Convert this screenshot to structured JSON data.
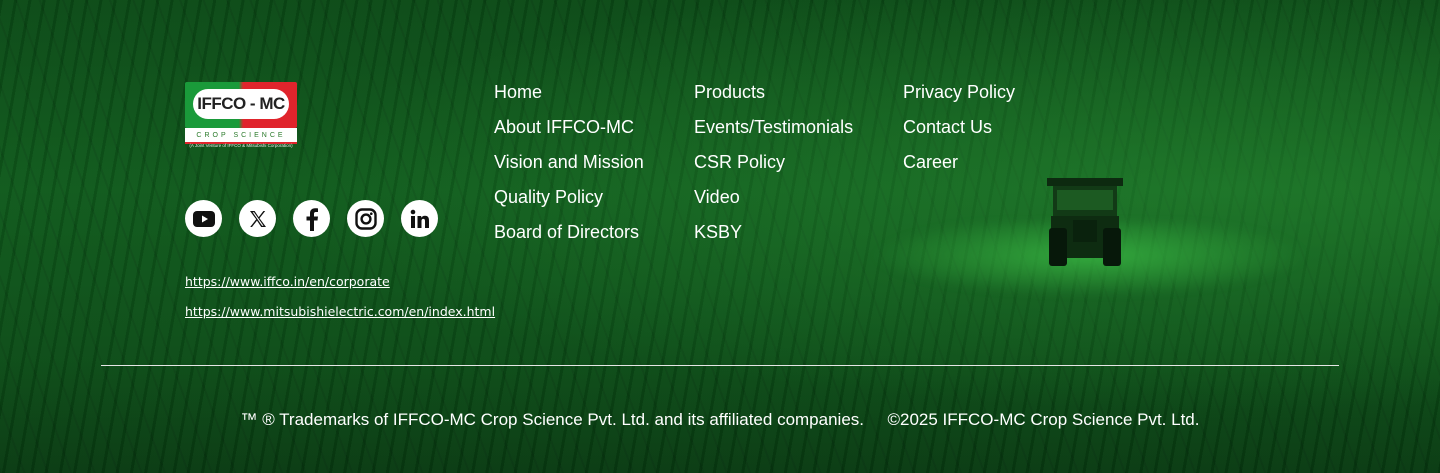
{
  "logo": {
    "name": "IFFCO - MC",
    "subtitle": "CROP SCIENCE",
    "joint_venture": "(A Joint Venture of IFFCO & Mitsubishi Corporation)"
  },
  "social": [
    {
      "name": "youtube",
      "icon": "youtube-icon"
    },
    {
      "name": "x",
      "icon": "x-icon"
    },
    {
      "name": "facebook",
      "icon": "facebook-icon"
    },
    {
      "name": "instagram",
      "icon": "instagram-icon"
    },
    {
      "name": "linkedin",
      "icon": "linkedin-icon"
    }
  ],
  "external_links": [
    "https://www.iffco.in/en/corporate",
    "https://www.mitsubishielectric.com/en/index.html"
  ],
  "nav": {
    "col1": [
      "Home",
      "About IFFCO-MC",
      "Vision and Mission",
      "Quality Policy",
      "Board of Directors"
    ],
    "col2": [
      "Products",
      "Events/Testimonials",
      "CSR Policy",
      "Video",
      "KSBY"
    ],
    "col3": [
      "Privacy Policy",
      "Contact Us",
      "Career"
    ]
  },
  "footer": {
    "trademark": "™ ® Trademarks of  IFFCO-MC Crop Science Pvt. Ltd. and its affiliated companies.",
    "copyright": "©2025 IFFCO-MC Crop Science Pvt. Ltd."
  },
  "colors": {
    "background": "#0f5a1c",
    "logo_green": "#1a9a3a",
    "logo_red": "#e0242c",
    "text": "#ffffff"
  }
}
